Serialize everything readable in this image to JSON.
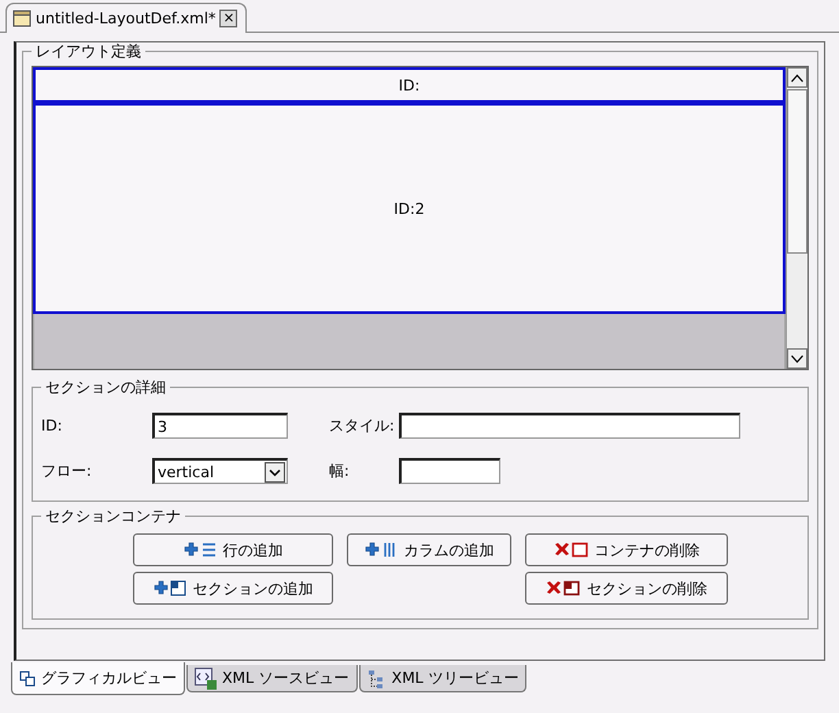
{
  "editor_tab": {
    "title": "untitled-LayoutDef.xml*",
    "close": "×"
  },
  "layout": {
    "legend": "レイアウト定義",
    "sections": [
      {
        "label": "ID:",
        "selected": false,
        "kind": "header"
      },
      {
        "label": "ID:2",
        "selected": false,
        "kind": "body"
      },
      {
        "selected": true,
        "kind": "body"
      }
    ]
  },
  "details": {
    "legend": "セクションの詳細",
    "fields": [
      {
        "label": "ID:",
        "value": "3",
        "kind": "text"
      },
      {
        "label": "スタイル:",
        "kind": "wide"
      },
      {
        "label": "フロー:",
        "value": "vertical",
        "kind": "select"
      },
      {
        "label": "幅:",
        "kind": "text"
      }
    ]
  },
  "container": {
    "legend": "セクションコンテナ",
    "buttons": [
      {
        "label": "行の追加",
        "kind": "add-row"
      },
      {
        "label": "カラムの追加",
        "kind": "add-column"
      },
      {
        "label": "コンテナの削除",
        "kind": "delete-container"
      },
      {
        "label": "セクションの追加",
        "kind": "add-section"
      },
      {
        "kind": "gap"
      },
      {
        "label": "セクションの削除",
        "kind": "delete-section"
      }
    ]
  },
  "view_tabs": [
    {
      "label": "グラフィカルビュー",
      "selected": true,
      "kind": "graphical"
    },
    {
      "label": "XML ソースビュー",
      "selected": false,
      "kind": "source"
    },
    {
      "label": "XML ツリービュー",
      "selected": false,
      "kind": "tree"
    }
  ]
}
